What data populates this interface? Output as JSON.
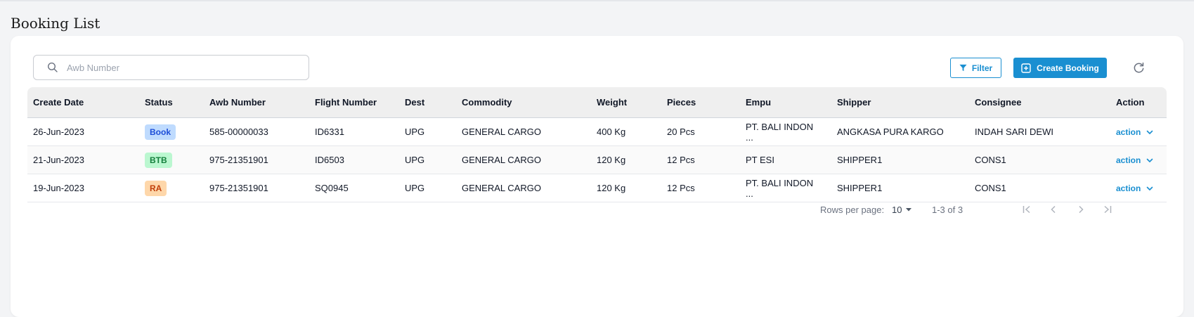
{
  "page": {
    "title": "Booking List"
  },
  "search": {
    "placeholder": "Awb Number",
    "value": ""
  },
  "toolbar": {
    "filter_label": "Filter",
    "create_label": "Create Booking"
  },
  "table": {
    "columns": [
      "Create Date",
      "Status",
      "Awb Number",
      "Flight Number",
      "Dest",
      "Commodity",
      "Weight",
      "Pieces",
      "Empu",
      "Shipper",
      "Consignee",
      "Action"
    ],
    "rows": [
      {
        "create_date": "26-Jun-2023",
        "status": "Book",
        "awb": "585-00000033",
        "flight": "ID6331",
        "dest": "UPG",
        "commodity": "GENERAL CARGO",
        "weight": "400 Kg",
        "pieces": "20 Pcs",
        "empu_line1": "PT. BALI INDON",
        "empu_line2": "...",
        "shipper": "ANGKASA PURA KARGO",
        "consignee": "INDAH SARI DEWI",
        "action": "action"
      },
      {
        "create_date": "21-Jun-2023",
        "status": "BTB",
        "awb": "975-21351901",
        "flight": "ID6503",
        "dest": "UPG",
        "commodity": "GENERAL CARGO",
        "weight": "120 Kg",
        "pieces": "12 Pcs",
        "empu_line1": "PT ESI",
        "empu_line2": "",
        "shipper": "SHIPPER1",
        "consignee": "CONS1",
        "action": "action"
      },
      {
        "create_date": "19-Jun-2023",
        "status": "RA",
        "awb": "975-21351901",
        "flight": "SQ0945",
        "dest": "UPG",
        "commodity": "GENERAL CARGO",
        "weight": "120 Kg",
        "pieces": "12 Pcs",
        "empu_line1": "PT. BALI INDON",
        "empu_line2": "...",
        "shipper": "SHIPPER1",
        "consignee": "CONS1",
        "action": "action"
      }
    ]
  },
  "pagination": {
    "rows_per_page_label": "Rows per page:",
    "rows_per_page": "10",
    "range": "1-3 of 3"
  },
  "colors": {
    "accent": "#1a8fd1",
    "book": "#bfdbfe",
    "btb": "#bbf7d0",
    "ra": "#fed7aa"
  }
}
